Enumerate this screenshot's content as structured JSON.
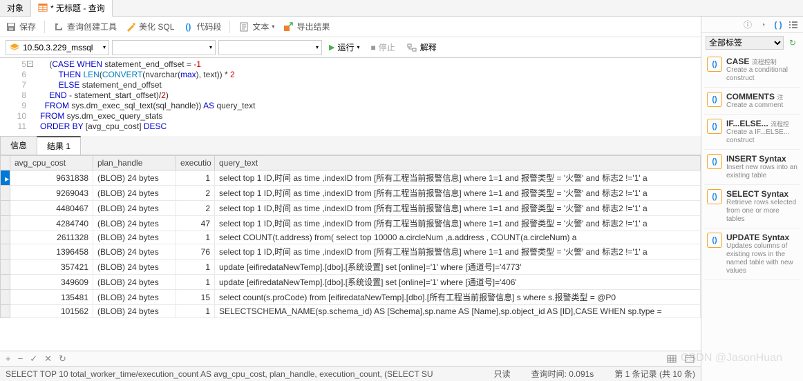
{
  "tabs": {
    "obj": "对象",
    "query_title": "* 无标题 - 查询"
  },
  "toolbar1": {
    "save": "保存",
    "builder": "查询创建工具",
    "beautify": "美化 SQL",
    "snippet": "代码段",
    "text": "文本",
    "export": "导出结果"
  },
  "toolbar2": {
    "connection": "10.50.3.229_mssql",
    "run": "运行",
    "stop": "停止",
    "explain": "解释"
  },
  "editor": {
    "lines": [
      {
        "n": 5,
        "fold": true,
        "html": "    (<span class='kw'>CASE</span> <span class='kw'>WHEN</span> statement_end_offset = <span class='num'>-1</span>"
      },
      {
        "n": 6,
        "html": "        <span class='kw'>THEN</span> <span class='fn'>LEN</span>(<span class='fn'>CONVERT</span>(nvarchar(<span class='kw'>max</span>), text)) * <span class='num'>2</span>"
      },
      {
        "n": 7,
        "html": "        <span class='kw'>ELSE</span> statement_end_offset"
      },
      {
        "n": 8,
        "html": "    <span class='kw'>END</span> - statement_start_offset)/<span class='num'>2</span>)"
      },
      {
        "n": 9,
        "html": "  <span class='kw'>FROM</span> sys.dm_exec_sql_text(sql_handle)) <span class='kw'>AS</span> query_text"
      },
      {
        "n": 10,
        "html": "<span class='kw'>FROM</span> sys.dm_exec_query_stats"
      },
      {
        "n": 11,
        "html": "<span class='kw'>ORDER BY</span> [avg_cpu_cost] <span class='kw'>DESC</span>"
      }
    ]
  },
  "result_tabs": {
    "info": "信息",
    "result1": "结果 1"
  },
  "columns": {
    "avg": "avg_cpu_cost",
    "plan": "plan_handle",
    "exec": "executio",
    "query": "query_text"
  },
  "rows": [
    {
      "avg": "9631838",
      "plan": "(BLOB) 24 bytes",
      "exec": "1",
      "query": "select top 1 ID,时间 as time ,indexID from [所有工程当前报警信息] where 1=1 and 报警类型 = '火警' and 标志2 !='1' a"
    },
    {
      "avg": "9269043",
      "plan": "(BLOB) 24 bytes",
      "exec": "2",
      "query": "select top 1 ID,时间 as time ,indexID from [所有工程当前报警信息] where 1=1 and 报警类型 = '火警' and 标志2 !='1' a"
    },
    {
      "avg": "4480467",
      "plan": "(BLOB) 24 bytes",
      "exec": "2",
      "query": "select top 1 ID,时间 as time ,indexID from [所有工程当前报警信息] where 1=1 and 报警类型 = '火警' and 标志2 !='1' a"
    },
    {
      "avg": "4284740",
      "plan": "(BLOB) 24 bytes",
      "exec": "47",
      "query": "select top 1 ID,时间 as time ,indexID from [所有工程当前报警信息] where 1=1 and 报警类型 = '火警' and 标志2 !='1' a"
    },
    {
      "avg": "2611328",
      "plan": "(BLOB) 24 bytes",
      "exec": "1",
      "query": "select COUNT(t.address) from(                                 select top 10000 a.circleNum ,a.address , COUNT(a.circleNum) a"
    },
    {
      "avg": "1396458",
      "plan": "(BLOB) 24 bytes",
      "exec": "76",
      "query": "select top 1 ID,时间 as time ,indexID from [所有工程当前报警信息] where 1=1 and 报警类型 = '火警' and 标志2 !='1' a"
    },
    {
      "avg": "357421",
      "plan": "(BLOB) 24 bytes",
      "exec": "1",
      "query": "update [eifiredataNewTemp].[dbo].[系统设置] set [online]='1' where [通道号]='4773'"
    },
    {
      "avg": "349609",
      "plan": "(BLOB) 24 bytes",
      "exec": "1",
      "query": "update [eifiredataNewTemp].[dbo].[系统设置] set [online]='1' where [通道号]='406'"
    },
    {
      "avg": "135481",
      "plan": "(BLOB) 24 bytes",
      "exec": "15",
      "query": "select count(s.proCode)          from [eifiredataNewTemp].[dbo].[所有工程当前报警信息] s           where s.报警类型 = @P0"
    },
    {
      "avg": "101562",
      "plan": "(BLOB) 24 bytes",
      "exec": "1",
      "query": "SELECTSCHEMA_NAME(sp.schema_id) AS [Schema],sp.name AS [Name],sp.object_id AS [ID],CASE WHEN sp.type ="
    }
  ],
  "status": {
    "sql": "SELECT TOP 10      total_worker_time/execution_count AS avg_cpu_cost, plan_handle,      execution_count,      (SELECT SU",
    "mode": "只读",
    "time_label": "查询时间:",
    "time_val": "0.091s",
    "records": "第 1 条记录 (共 10 条)"
  },
  "right": {
    "tag_select": "全部标签",
    "snippets": [
      {
        "title": "CASE",
        "sub": "流程控制",
        "desc": "Create a conditional construct"
      },
      {
        "title": "COMMENTS",
        "sub": "注",
        "desc": "Create a comment"
      },
      {
        "title": "IF...ELSE...",
        "sub": "流程控",
        "desc": "Create a IF...ELSE... construct"
      },
      {
        "title": "INSERT Syntax",
        "sub": "",
        "desc": "Insert new rows into an existing table"
      },
      {
        "title": "SELECT Syntax",
        "sub": "",
        "desc": "Retrieve rows selected from one or more tables"
      },
      {
        "title": "UPDATE Syntax",
        "sub": "",
        "desc": "Updates columns of existing rows in the named table with new values"
      }
    ]
  },
  "watermark": "CSDN @JasonHuan"
}
